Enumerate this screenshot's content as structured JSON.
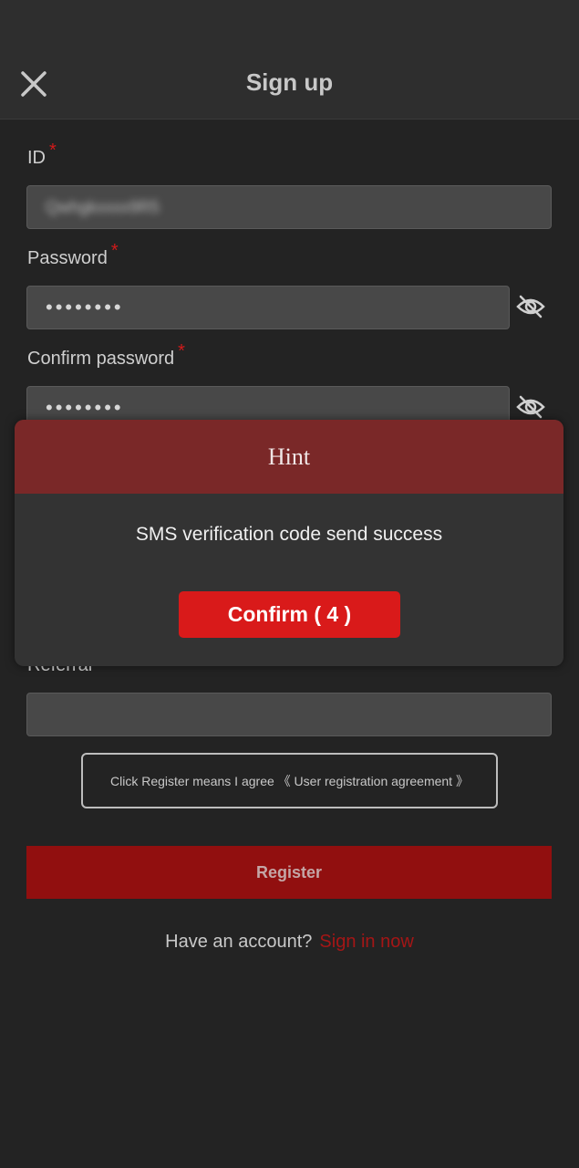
{
  "header": {
    "title": "Sign up",
    "close_icon": "close-icon"
  },
  "form": {
    "id": {
      "label": "ID",
      "required": "*",
      "value": "Qwhgkxxxx9R5"
    },
    "password": {
      "label": "Password",
      "required": "*",
      "value": "••••••••"
    },
    "confirm_password": {
      "label": "Confirm password",
      "required": "*",
      "value": "••••••••"
    },
    "referral": {
      "label": "Referral",
      "value": ""
    }
  },
  "agreement": {
    "text": "Click Register means I agree 《 User registration agreement 》"
  },
  "register_label": "Register",
  "footer": {
    "prompt": "Have an account?",
    "link": "Sign in now"
  },
  "modal": {
    "title": "Hint",
    "message": "SMS verification code send success",
    "confirm_label": "Confirm ( 4 )"
  },
  "colors": {
    "background": "#232323",
    "accent": "#d91a1a",
    "register_bg": "#910f0f",
    "modal_header": "#7a2828",
    "link": "#a41616"
  }
}
